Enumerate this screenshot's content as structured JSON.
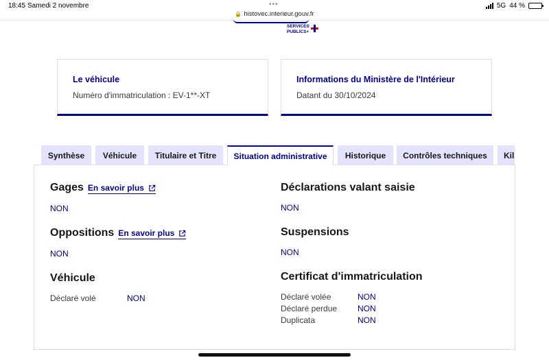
{
  "status_bar": {
    "time": "18:45",
    "date": "Samedi 2 novembre",
    "url": "histovec.interieur.gouv.fr",
    "network": "5G",
    "battery": "44 %",
    "battery_level": 0.44
  },
  "header": {
    "logo_line1": "SERVICES",
    "logo_line2": "PUBLICS+"
  },
  "cards": {
    "vehicle": {
      "title": "Le véhicule",
      "text": "Numéro d'immatriculation : EV-1**-XT"
    },
    "ministry": {
      "title": "Informations du Ministère de l'Intérieur",
      "text": "Datant du 30/10/2024"
    }
  },
  "tabs": [
    {
      "label": "Synthèse"
    },
    {
      "label": "Véhicule"
    },
    {
      "label": "Titulaire et Titre"
    },
    {
      "label": "Situation administrative"
    },
    {
      "label": "Historique"
    },
    {
      "label": "Contrôles techniques"
    },
    {
      "label": "Kil"
    }
  ],
  "active_tab": "Situation administrative",
  "situation": {
    "gages": {
      "title": "Gages",
      "link": "En savoir plus",
      "value": "NON"
    },
    "oppositions": {
      "title": "Oppositions",
      "link": "En savoir plus",
      "value": "NON"
    },
    "vehicule": {
      "title": "Véhicule",
      "stolen_label": "Déclaré volé",
      "stolen_value": "NON"
    },
    "saisie": {
      "title": "Déclarations valant saisie",
      "value": "NON"
    },
    "suspensions": {
      "title": "Suspensions",
      "value": "NON"
    },
    "certificat": {
      "title": "Certificat d'immatriculation",
      "rows": [
        {
          "label": "Déclaré volée",
          "value": "NON"
        },
        {
          "label": "Déclaré perdue",
          "value": "NON"
        },
        {
          "label": "Duplicata",
          "value": "NON"
        }
      ]
    }
  },
  "colors": {
    "primary": "#000091",
    "tab_bg": "#e3e3fd",
    "text": "#161616",
    "border": "#dddddd"
  }
}
